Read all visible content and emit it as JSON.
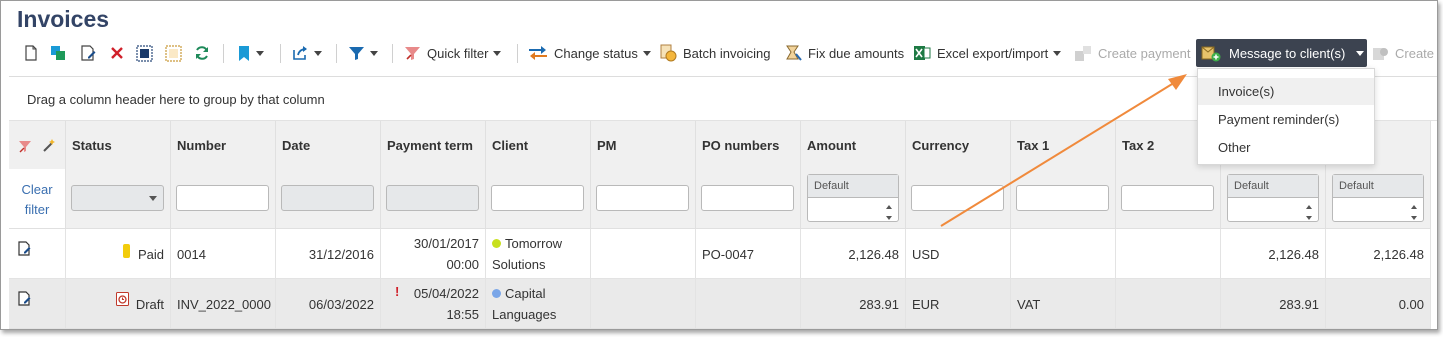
{
  "page": {
    "title": "Invoices"
  },
  "toolbar": {
    "quick_filter": "Quick filter",
    "change_status": "Change status",
    "batch_invoicing": "Batch invoicing",
    "fix_due_amounts": "Fix due amounts",
    "excel_export_import": "Excel export/import",
    "create_payment": "Create payment",
    "message_to_clients": "Message to client(s)",
    "create_truncated": "Create",
    "icons": [
      "new-document-icon",
      "copy-icon",
      "edit-icon",
      "delete-icon",
      "select-all-icon",
      "deselect-icon",
      "refresh-icon",
      "bookmark-icon",
      "export-icon",
      "filter-icon",
      "quick-filter-icon",
      "change-status-icon",
      "batch-invoicing-icon",
      "fix-due-amounts-icon",
      "excel-icon",
      "create-payment-icon",
      "message-icon",
      "create-icon"
    ]
  },
  "dropdown": {
    "items": [
      "Invoice(s)",
      "Payment reminder(s)",
      "Other"
    ]
  },
  "grid": {
    "group_hint": "Drag a column header here to group by that column",
    "clear_filter": "Clear filter",
    "columns": [
      "Status",
      "Number",
      "Date",
      "Payment term",
      "Client",
      "PM",
      "PO numbers",
      "Amount",
      "Currency",
      "Tax 1",
      "Tax 2",
      "",
      ""
    ],
    "numeric_filter_default": "Default",
    "rows": [
      {
        "status": "Paid",
        "number": "0014",
        "date": "31/12/2016",
        "payment_term_date": "30/01/2017",
        "payment_term_time": "00:00",
        "client_line1": "Tomorrow",
        "client_line2": "Solutions",
        "pm": "",
        "po": "PO-0047",
        "amount": "2,126.48",
        "currency": "USD",
        "tax1": "",
        "tax2": "",
        "extra1": "2,126.48",
        "extra2": "2,126.48",
        "status_color": "#f2cc0c",
        "client_color": "#c8e01e",
        "overdue_mark": ""
      },
      {
        "status": "Draft",
        "number": "INV_2022_0000",
        "date": "06/03/2022",
        "payment_term_date": "05/04/2022",
        "payment_term_time": "18:55",
        "client_line1": "Capital",
        "client_line2": "Languages",
        "pm": "",
        "po": "",
        "amount": "283.91",
        "currency": "EUR",
        "tax1": "VAT",
        "tax2": "",
        "extra1": "283.91",
        "extra2": "0.00",
        "status_color": "#c0392b",
        "client_color": "#7aa6e8",
        "overdue_mark": "!"
      }
    ]
  },
  "colors": {
    "accent_dark": "#3c4350",
    "link": "#3a6fb0",
    "arrow": "#f08a3c"
  }
}
